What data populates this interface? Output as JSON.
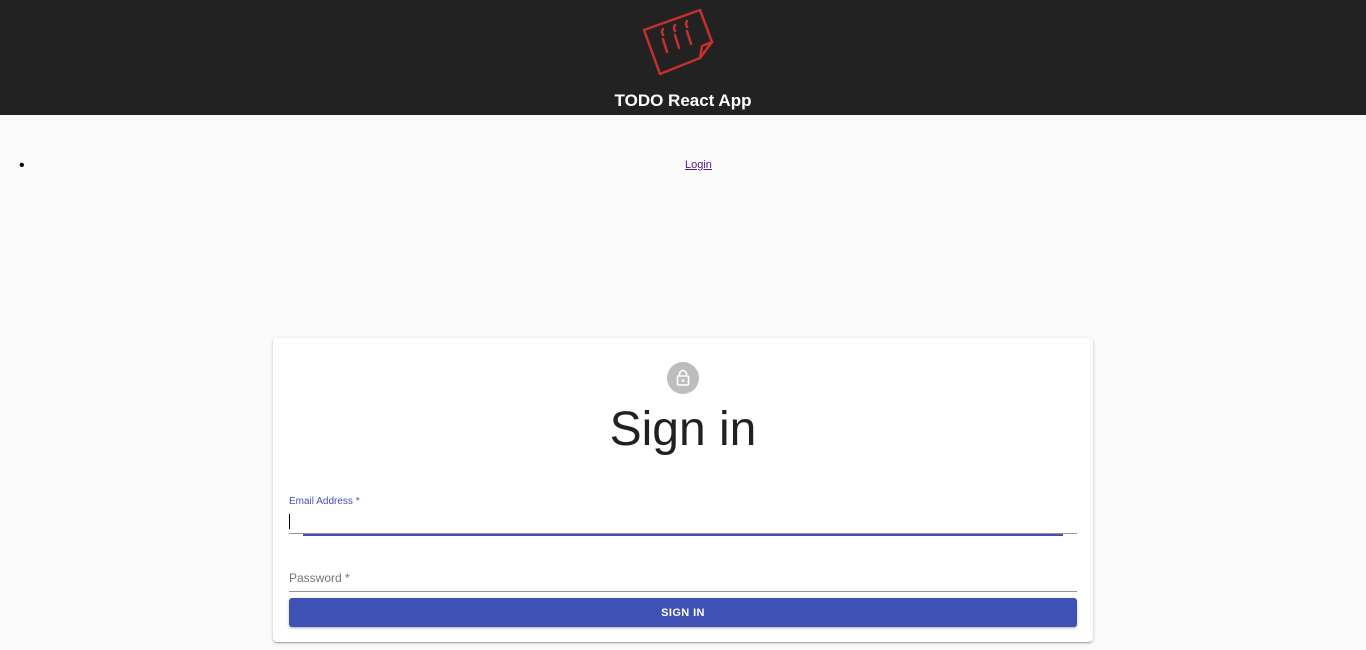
{
  "header": {
    "title": "TODO React App",
    "logo_icon": "todo-note-logo-icon",
    "background": "#222222",
    "logo_color": "#c62f2f"
  },
  "nav": {
    "items": [
      {
        "label": "Login"
      }
    ]
  },
  "signin": {
    "avatar_icon": "lock-icon",
    "title": "Sign in",
    "email": {
      "label": "Email Address *",
      "value": ""
    },
    "password": {
      "placeholder": "Password *",
      "value": ""
    },
    "submit_label": "SIGN IN",
    "accent": "#3f51b5"
  }
}
